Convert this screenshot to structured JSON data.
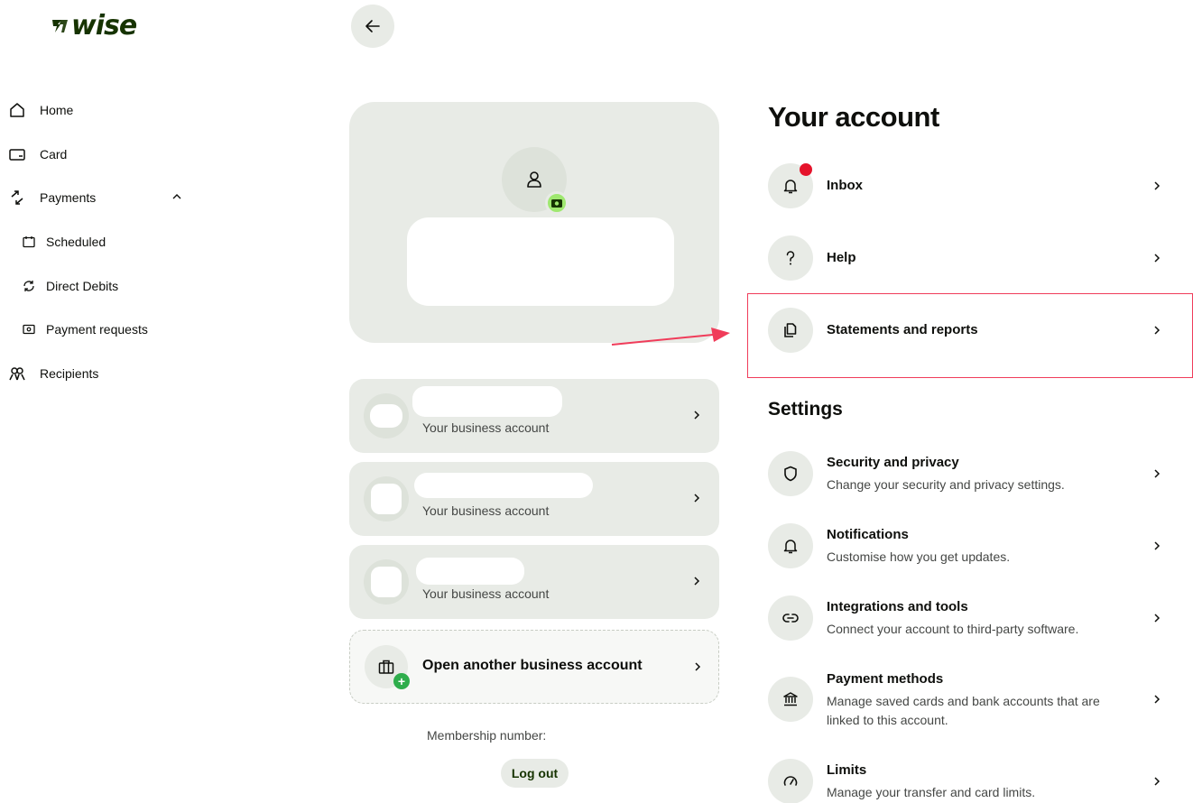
{
  "brand": {
    "logo_text": "wise",
    "logo_color": "#163300",
    "accent_green": "#9fe870"
  },
  "sidebar": {
    "items": [
      {
        "label": "Home",
        "icon": "home-icon"
      },
      {
        "label": "Card",
        "icon": "card-icon"
      },
      {
        "label": "Payments",
        "icon": "payments-icon",
        "expanded": true
      },
      {
        "label": "Scheduled",
        "icon": "calendar-icon"
      },
      {
        "label": "Direct Debits",
        "icon": "refresh-icon"
      },
      {
        "label": "Payment requests",
        "icon": "request-icon"
      },
      {
        "label": "Recipients",
        "icon": "recipients-icon"
      }
    ]
  },
  "accounts": [
    {
      "subtitle": "Your business account"
    },
    {
      "subtitle": "Your business account"
    },
    {
      "subtitle": "Your business account"
    }
  ],
  "open_account": {
    "label": "Open another business account"
  },
  "membership": {
    "label": "Membership number:"
  },
  "logout": {
    "label": "Log out"
  },
  "your_account": {
    "title": "Your account",
    "items": [
      {
        "title": "Inbox",
        "icon": "bell-icon",
        "has_notification": true
      },
      {
        "title": "Help",
        "icon": "question-icon"
      },
      {
        "title": "Statements and reports",
        "icon": "documents-icon",
        "highlighted": true
      }
    ]
  },
  "settings": {
    "title": "Settings",
    "items": [
      {
        "title": "Security and privacy",
        "description": "Change your security and privacy settings.",
        "icon": "shield-icon"
      },
      {
        "title": "Notifications",
        "description": "Customise how you get updates.",
        "icon": "bell-icon"
      },
      {
        "title": "Integrations and tools",
        "description": "Connect your account to third-party software.",
        "icon": "link-icon"
      },
      {
        "title": "Payment methods",
        "description": "Manage saved cards and bank accounts that are linked to this account.",
        "icon": "bank-icon"
      },
      {
        "title": "Limits",
        "description": "Manage your transfer and card limits.",
        "icon": "gauge-icon"
      }
    ]
  },
  "colors": {
    "card_bg": "#e8ebe6",
    "highlight": "#f03c5a",
    "notification": "#e5132b"
  }
}
